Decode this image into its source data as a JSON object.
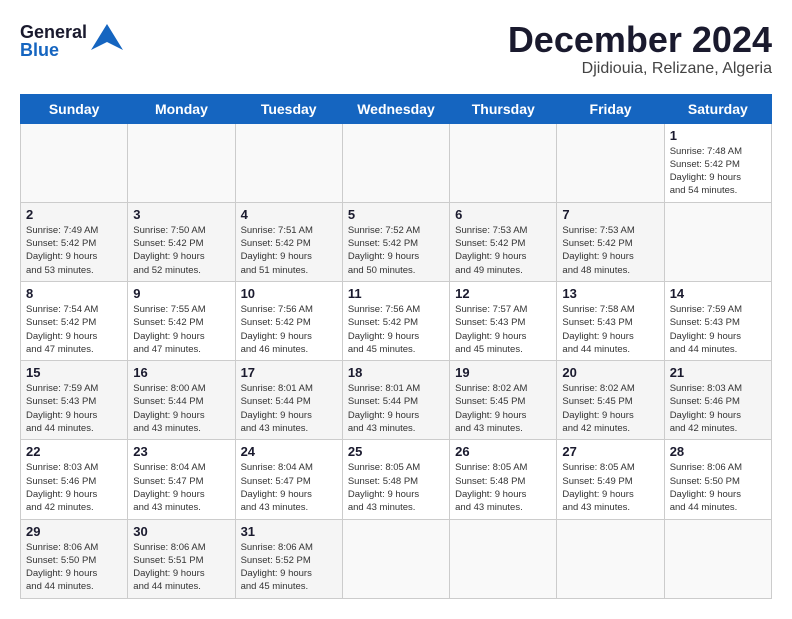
{
  "header": {
    "logo_general": "General",
    "logo_blue": "Blue",
    "title": "December 2024",
    "subtitle": "Djidiouia, Relizane, Algeria"
  },
  "calendar": {
    "days_of_week": [
      "Sunday",
      "Monday",
      "Tuesday",
      "Wednesday",
      "Thursday",
      "Friday",
      "Saturday"
    ],
    "weeks": [
      [
        null,
        null,
        null,
        null,
        null,
        null,
        {
          "day": 1,
          "sunrise": "7:48 AM",
          "sunset": "5:42 PM",
          "daylight": "9 hours and 54 minutes."
        }
      ],
      [
        {
          "day": 2,
          "sunrise": "7:49 AM",
          "sunset": "5:42 PM",
          "daylight": "9 hours and 53 minutes."
        },
        {
          "day": 3,
          "sunrise": "7:50 AM",
          "sunset": "5:42 PM",
          "daylight": "9 hours and 52 minutes."
        },
        {
          "day": 4,
          "sunrise": "7:51 AM",
          "sunset": "5:42 PM",
          "daylight": "9 hours and 51 minutes."
        },
        {
          "day": 5,
          "sunrise": "7:52 AM",
          "sunset": "5:42 PM",
          "daylight": "9 hours and 50 minutes."
        },
        {
          "day": 6,
          "sunrise": "7:53 AM",
          "sunset": "5:42 PM",
          "daylight": "9 hours and 49 minutes."
        },
        {
          "day": 7,
          "sunrise": "7:53 AM",
          "sunset": "5:42 PM",
          "daylight": "9 hours and 48 minutes."
        },
        null
      ],
      [
        {
          "day": 8,
          "sunrise": "7:54 AM",
          "sunset": "5:42 PM",
          "daylight": "9 hours and 47 minutes."
        },
        {
          "day": 9,
          "sunrise": "7:55 AM",
          "sunset": "5:42 PM",
          "daylight": "9 hours and 47 minutes."
        },
        {
          "day": 10,
          "sunrise": "7:56 AM",
          "sunset": "5:42 PM",
          "daylight": "9 hours and 46 minutes."
        },
        {
          "day": 11,
          "sunrise": "7:56 AM",
          "sunset": "5:42 PM",
          "daylight": "9 hours and 45 minutes."
        },
        {
          "day": 12,
          "sunrise": "7:57 AM",
          "sunset": "5:43 PM",
          "daylight": "9 hours and 45 minutes."
        },
        {
          "day": 13,
          "sunrise": "7:58 AM",
          "sunset": "5:43 PM",
          "daylight": "9 hours and 44 minutes."
        },
        {
          "day": 14,
          "sunrise": "7:59 AM",
          "sunset": "5:43 PM",
          "daylight": "9 hours and 44 minutes."
        }
      ],
      [
        {
          "day": 15,
          "sunrise": "7:59 AM",
          "sunset": "5:43 PM",
          "daylight": "9 hours and 44 minutes."
        },
        {
          "day": 16,
          "sunrise": "8:00 AM",
          "sunset": "5:44 PM",
          "daylight": "9 hours and 43 minutes."
        },
        {
          "day": 17,
          "sunrise": "8:01 AM",
          "sunset": "5:44 PM",
          "daylight": "9 hours and 43 minutes."
        },
        {
          "day": 18,
          "sunrise": "8:01 AM",
          "sunset": "5:44 PM",
          "daylight": "9 hours and 43 minutes."
        },
        {
          "day": 19,
          "sunrise": "8:02 AM",
          "sunset": "5:45 PM",
          "daylight": "9 hours and 43 minutes."
        },
        {
          "day": 20,
          "sunrise": "8:02 AM",
          "sunset": "5:45 PM",
          "daylight": "9 hours and 42 minutes."
        },
        {
          "day": 21,
          "sunrise": "8:03 AM",
          "sunset": "5:46 PM",
          "daylight": "9 hours and 42 minutes."
        }
      ],
      [
        {
          "day": 22,
          "sunrise": "8:03 AM",
          "sunset": "5:46 PM",
          "daylight": "9 hours and 42 minutes."
        },
        {
          "day": 23,
          "sunrise": "8:04 AM",
          "sunset": "5:47 PM",
          "daylight": "9 hours and 43 minutes."
        },
        {
          "day": 24,
          "sunrise": "8:04 AM",
          "sunset": "5:47 PM",
          "daylight": "9 hours and 43 minutes."
        },
        {
          "day": 25,
          "sunrise": "8:05 AM",
          "sunset": "5:48 PM",
          "daylight": "9 hours and 43 minutes."
        },
        {
          "day": 26,
          "sunrise": "8:05 AM",
          "sunset": "5:48 PM",
          "daylight": "9 hours and 43 minutes."
        },
        {
          "day": 27,
          "sunrise": "8:05 AM",
          "sunset": "5:49 PM",
          "daylight": "9 hours and 43 minutes."
        },
        {
          "day": 28,
          "sunrise": "8:06 AM",
          "sunset": "5:50 PM",
          "daylight": "9 hours and 44 minutes."
        }
      ],
      [
        {
          "day": 29,
          "sunrise": "8:06 AM",
          "sunset": "5:50 PM",
          "daylight": "9 hours and 44 minutes."
        },
        {
          "day": 30,
          "sunrise": "8:06 AM",
          "sunset": "5:51 PM",
          "daylight": "9 hours and 44 minutes."
        },
        {
          "day": 31,
          "sunrise": "8:06 AM",
          "sunset": "5:52 PM",
          "daylight": "9 hours and 45 minutes."
        },
        null,
        null,
        null,
        null
      ]
    ]
  }
}
